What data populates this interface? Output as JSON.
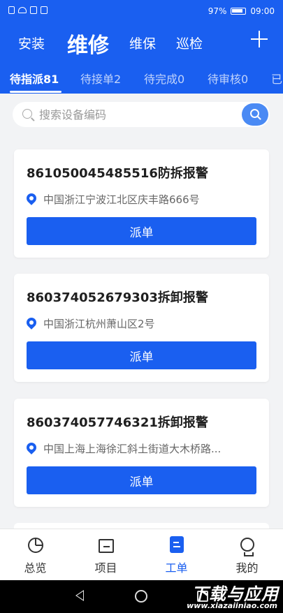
{
  "status_bar": {
    "battery": "97%",
    "time": "09:00"
  },
  "category_nav": {
    "items": [
      "安装",
      "维修",
      "维保",
      "巡检"
    ],
    "active": "维修"
  },
  "tabs": [
    "待指派81",
    "待接单2",
    "待完成0",
    "待审核0",
    "已"
  ],
  "search": {
    "placeholder": "搜索设备编码",
    "value": ""
  },
  "orders": [
    {
      "title": "861050045485516防拆报警",
      "address": "中国浙江宁波江北区庆丰路666号",
      "action": "派单"
    },
    {
      "title": "860374052679303拆卸报警",
      "address": "中国浙江杭州萧山区2号",
      "action": "派单"
    },
    {
      "title": "860374057746321拆卸报警",
      "address": "中国上海上海徐汇斜土街道大木桥路...",
      "action": "派单"
    }
  ],
  "bottom_nav": {
    "items": [
      "总览",
      "项目",
      "工单",
      "我的"
    ],
    "active": "工单"
  },
  "watermark": {
    "main": "下载与应用",
    "sub": "www.xiazaiiniao.com"
  },
  "colors": {
    "primary": "#1a5ff0",
    "search_button": "#4a8af4",
    "background": "#f2f3f5"
  }
}
